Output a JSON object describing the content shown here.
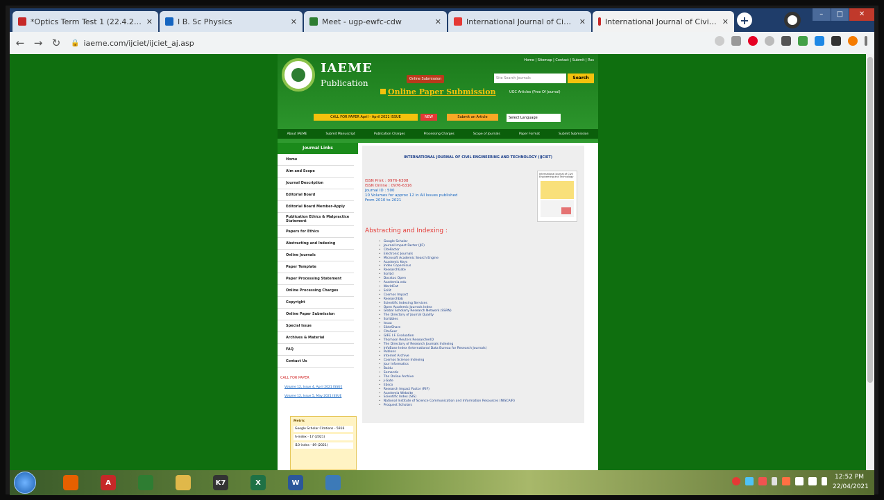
{
  "browser": {
    "tabs": [
      {
        "label": "*Optics Term Test 1 (22.4.2021)",
        "icon_color": "#c62828"
      },
      {
        "label": "I B. Sc Physics",
        "icon_color": "#1565c0"
      },
      {
        "label": "Meet - ugp-ewfc-cdw",
        "icon_color": "#2e7d32"
      },
      {
        "label": "International Journal of Civil E",
        "icon_color": "#e53935"
      },
      {
        "label": "International Journal of Civil E",
        "icon_color": "#c62828"
      }
    ],
    "url": "iaeme.com/ijciet/ijciet_aj.asp"
  },
  "site": {
    "brand_name": "IAEME",
    "brand_sub": "Publication",
    "top_links": "Home | Sitemap | Contact | Submit | Rss",
    "search_placeholder": "Site Search Journals",
    "search_button": "Search",
    "author_button": "Online Submission",
    "online_paper_submission": "Online Paper Submission",
    "ugc_text": "UGC Articles (Free Of Journal)",
    "call_for_papers_bar": "CALL FOR PAPER April - April 2021 ISSUE",
    "new_tag": "NEW",
    "submit_button": "Submit an Article",
    "language_select": "Select Language",
    "nav": [
      "About IAEME",
      "Submit Manuscript",
      "Publication Charges",
      "Processing Charges",
      "Scope of Journals",
      "Paper Format",
      "Submit Submission"
    ]
  },
  "left_menu": {
    "header": "Journal Links",
    "items": [
      "Home",
      "Aim and Scope",
      "Journal Description",
      "Editorial Board",
      "Editorial Board Member-Apply",
      "Publication Ethics & Malpractice Statement",
      "Papers for Ethics",
      "Abstracting and Indexing",
      "Online Journals",
      "Paper Template",
      "Paper Processing Statement",
      "Online Processing Charges",
      "Copyright",
      "Online Paper Submission",
      "Special Issue",
      "Archives & Material",
      "FAQ",
      "Contact Us"
    ],
    "call_for_paper_title": "CALL FOR PAPER",
    "call_for_paper_links": [
      "Volume 12, Issue 4, April 2021 ISSUE",
      "Volume 12, Issue 5, May 2021 ISSUE"
    ],
    "score_box": {
      "title": "Metric",
      "line1": "Google Scholar Citations - 5916",
      "line2": "h-index - 17 (2021)",
      "line3": "i10-index - 89 (2021)"
    }
  },
  "content": {
    "journal_title": "INTERNATIONAL JOURNAL OF CIVIL ENGINEERING AND TECHNOLOGY (IJCIET)",
    "details": [
      {
        "text": "ISSN Print : 0976-6308",
        "color": "red"
      },
      {
        "text": "ISSN Online : 0976-6316",
        "color": "red"
      },
      {
        "text": "Journal ID : 500",
        "color": "blue"
      },
      {
        "text": "10 Volumes for approx 12 in All Issues published",
        "color": "blue"
      },
      {
        "text": "From 2010 to 2021",
        "color": "blue"
      }
    ],
    "cover_text": "International Journal of Civil Engineering and Technology",
    "abstracting_heading": "Abstracting and Indexing :",
    "indexing_list": [
      "Google Scholar",
      "Journal Impact Factor (JIF)",
      "CiteFactor",
      "Electronic Journals",
      "Microsoft Academic Search Engine",
      "Academic Keys",
      "Index Copernicus",
      "ResearchGate",
      "Scribd",
      "Docstoc Open",
      "Academia.edu",
      "WorldCat",
      "Scilit",
      "Cosmos Impact",
      "Researchbib",
      "Scientific Indexing Services",
      "Open Academic Journals Index",
      "Global Scholarly Research Network (SSRN)",
      "The Directory of Journal Quality",
      "Scribbles",
      "Issuu",
      "SlideShare",
      "CiteSeer",
      "GIFE I.F. Evaluation",
      "Thomson Reuters ResearcherID",
      "The Directory of Research Journals Indexing",
      "InfoBase Index (International Data Bureau for Research Journals)",
      "Publons",
      "Internet Archive",
      "Cosmos Science Indexing",
      "Jour Informatics",
      "Baidu",
      "Semantic",
      "The Online Archive",
      "J-Gate",
      "Ebsco",
      "Research Impact Factor (RIF)",
      "Academia Website",
      "Scientific Index (SIS)",
      "National Institute of Science Communication and Information Resources (NISCAIR)",
      "Proquest Scholars"
    ]
  },
  "taskbar": {
    "apps": [
      {
        "name": "firefox",
        "color": "#e66000",
        "glyph": ""
      },
      {
        "name": "acrobat",
        "color": "#c62828",
        "glyph": "A"
      },
      {
        "name": "chrome",
        "color": "#2e7d32",
        "glyph": ""
      },
      {
        "name": "explorer",
        "color": "#e0b84a",
        "glyph": ""
      },
      {
        "name": "k7",
        "color": "#333333",
        "glyph": "K7"
      },
      {
        "name": "excel",
        "color": "#1e7145",
        "glyph": "X"
      },
      {
        "name": "word",
        "color": "#2b579a",
        "glyph": "W"
      },
      {
        "name": "media",
        "color": "#3c7ab8",
        "glyph": ""
      }
    ],
    "time": "12:52 PM",
    "date": "22/04/2021"
  }
}
